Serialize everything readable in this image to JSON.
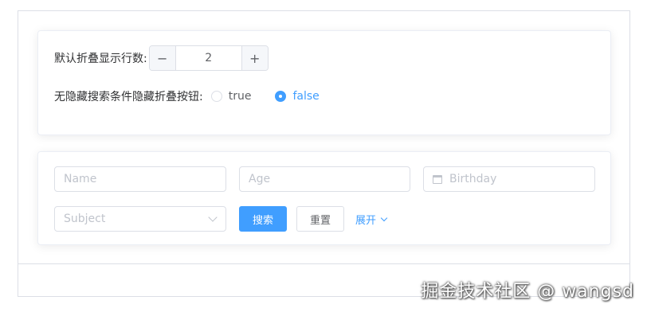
{
  "settings": {
    "rows_label": "默认折叠显示行数:",
    "stepper": {
      "minus": "−",
      "value": "2",
      "plus": "+"
    },
    "hide_label": "无隐藏搜索条件隐藏折叠按钮:",
    "radio_options": [
      {
        "label": "true",
        "checked": false
      },
      {
        "label": "false",
        "checked": true
      }
    ]
  },
  "search_form": {
    "name_placeholder": "Name",
    "age_placeholder": "Age",
    "birthday_placeholder": "Birthday",
    "subject_placeholder": "Subject",
    "search_button": "搜索",
    "reset_button": "重置",
    "expand_link": "展开"
  },
  "watermark": "掘金技术社区 @ wangsd",
  "colors": {
    "primary": "#409eff",
    "border": "#dcdfe6",
    "text": "#606266",
    "placeholder": "#c0c4cc"
  },
  "icons": {
    "calendar": "calendar-icon",
    "dropdown": "chevron-down-icon"
  }
}
